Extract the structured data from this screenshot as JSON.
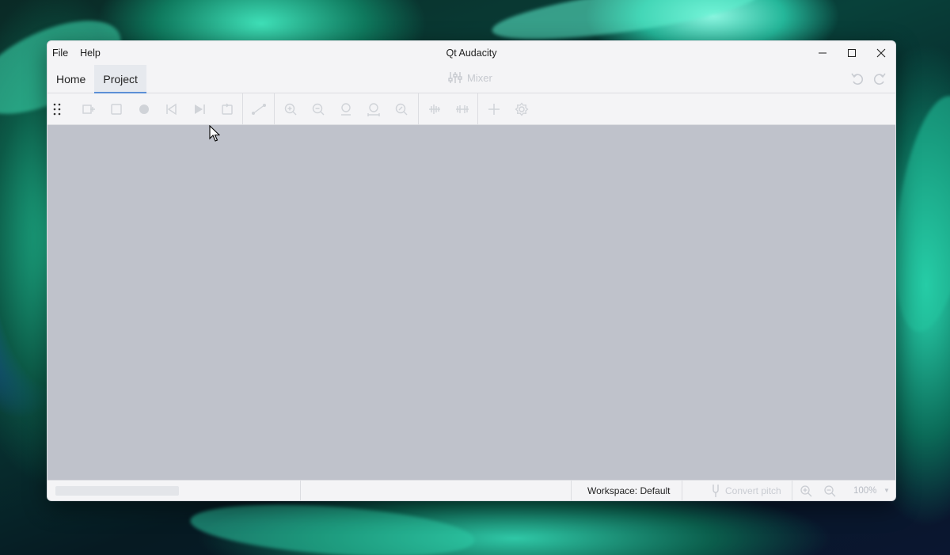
{
  "window": {
    "title": "Qt Audacity"
  },
  "menu": [
    "File",
    "Help"
  ],
  "tabs": [
    {
      "label": "Home",
      "active": false
    },
    {
      "label": "Project",
      "active": true
    }
  ],
  "header": {
    "mixer_label": "Mixer",
    "icons": [
      "undo-icon",
      "redo-icon"
    ]
  },
  "toolbar": {
    "groups": [
      [
        "grip-icon"
      ],
      [
        "add-track-icon",
        "stop-icon",
        "record-icon",
        "rewind-icon",
        "play-icon",
        "loop-icon"
      ],
      [
        "automation-icon"
      ],
      [
        "zoom-in-icon",
        "zoom-out-icon",
        "fit-selection-icon",
        "fit-project-icon",
        "zoom-toggle-icon"
      ],
      [
        "trim-icon",
        "silence-icon"
      ],
      [
        "add-icon",
        "settings-icon"
      ]
    ]
  },
  "statusbar": {
    "workspace": "Workspace: Default",
    "convert_pitch": "Convert pitch",
    "zoom_percent": "100%"
  },
  "colors": {
    "workspace_bg": "#bfc2cb",
    "window_bg": "#f4f4f6",
    "active_tab_underline": "#5c8fd6",
    "disabled_icon": "#c6c9cf"
  }
}
